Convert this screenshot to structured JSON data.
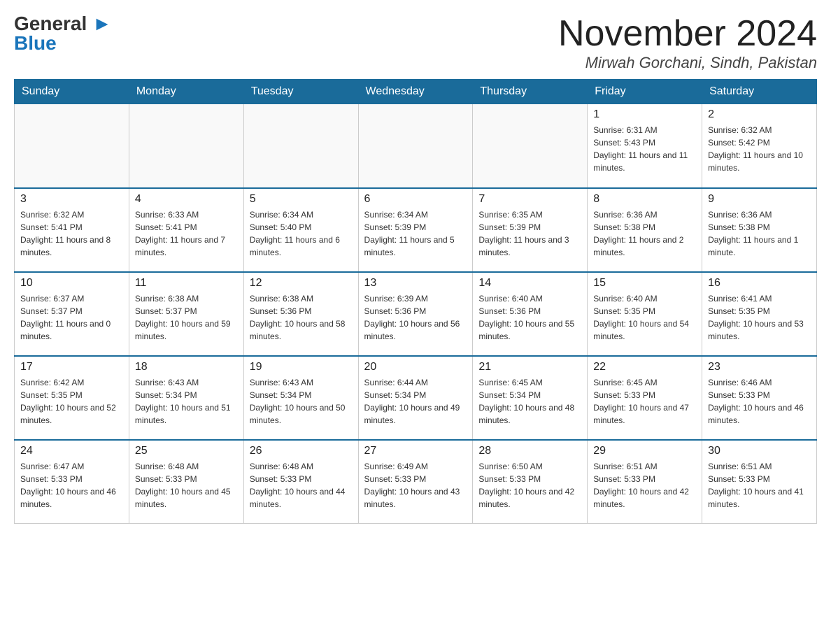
{
  "header": {
    "logo_general": "General",
    "logo_blue": "Blue",
    "month_title": "November 2024",
    "location": "Mirwah Gorchani, Sindh, Pakistan"
  },
  "weekdays": [
    "Sunday",
    "Monday",
    "Tuesday",
    "Wednesday",
    "Thursday",
    "Friday",
    "Saturday"
  ],
  "weeks": [
    [
      {
        "day": "",
        "sunrise": "",
        "sunset": "",
        "daylight": ""
      },
      {
        "day": "",
        "sunrise": "",
        "sunset": "",
        "daylight": ""
      },
      {
        "day": "",
        "sunrise": "",
        "sunset": "",
        "daylight": ""
      },
      {
        "day": "",
        "sunrise": "",
        "sunset": "",
        "daylight": ""
      },
      {
        "day": "",
        "sunrise": "",
        "sunset": "",
        "daylight": ""
      },
      {
        "day": "1",
        "sunrise": "Sunrise: 6:31 AM",
        "sunset": "Sunset: 5:43 PM",
        "daylight": "Daylight: 11 hours and 11 minutes."
      },
      {
        "day": "2",
        "sunrise": "Sunrise: 6:32 AM",
        "sunset": "Sunset: 5:42 PM",
        "daylight": "Daylight: 11 hours and 10 minutes."
      }
    ],
    [
      {
        "day": "3",
        "sunrise": "Sunrise: 6:32 AM",
        "sunset": "Sunset: 5:41 PM",
        "daylight": "Daylight: 11 hours and 8 minutes."
      },
      {
        "day": "4",
        "sunrise": "Sunrise: 6:33 AM",
        "sunset": "Sunset: 5:41 PM",
        "daylight": "Daylight: 11 hours and 7 minutes."
      },
      {
        "day": "5",
        "sunrise": "Sunrise: 6:34 AM",
        "sunset": "Sunset: 5:40 PM",
        "daylight": "Daylight: 11 hours and 6 minutes."
      },
      {
        "day": "6",
        "sunrise": "Sunrise: 6:34 AM",
        "sunset": "Sunset: 5:39 PM",
        "daylight": "Daylight: 11 hours and 5 minutes."
      },
      {
        "day": "7",
        "sunrise": "Sunrise: 6:35 AM",
        "sunset": "Sunset: 5:39 PM",
        "daylight": "Daylight: 11 hours and 3 minutes."
      },
      {
        "day": "8",
        "sunrise": "Sunrise: 6:36 AM",
        "sunset": "Sunset: 5:38 PM",
        "daylight": "Daylight: 11 hours and 2 minutes."
      },
      {
        "day": "9",
        "sunrise": "Sunrise: 6:36 AM",
        "sunset": "Sunset: 5:38 PM",
        "daylight": "Daylight: 11 hours and 1 minute."
      }
    ],
    [
      {
        "day": "10",
        "sunrise": "Sunrise: 6:37 AM",
        "sunset": "Sunset: 5:37 PM",
        "daylight": "Daylight: 11 hours and 0 minutes."
      },
      {
        "day": "11",
        "sunrise": "Sunrise: 6:38 AM",
        "sunset": "Sunset: 5:37 PM",
        "daylight": "Daylight: 10 hours and 59 minutes."
      },
      {
        "day": "12",
        "sunrise": "Sunrise: 6:38 AM",
        "sunset": "Sunset: 5:36 PM",
        "daylight": "Daylight: 10 hours and 58 minutes."
      },
      {
        "day": "13",
        "sunrise": "Sunrise: 6:39 AM",
        "sunset": "Sunset: 5:36 PM",
        "daylight": "Daylight: 10 hours and 56 minutes."
      },
      {
        "day": "14",
        "sunrise": "Sunrise: 6:40 AM",
        "sunset": "Sunset: 5:36 PM",
        "daylight": "Daylight: 10 hours and 55 minutes."
      },
      {
        "day": "15",
        "sunrise": "Sunrise: 6:40 AM",
        "sunset": "Sunset: 5:35 PM",
        "daylight": "Daylight: 10 hours and 54 minutes."
      },
      {
        "day": "16",
        "sunrise": "Sunrise: 6:41 AM",
        "sunset": "Sunset: 5:35 PM",
        "daylight": "Daylight: 10 hours and 53 minutes."
      }
    ],
    [
      {
        "day": "17",
        "sunrise": "Sunrise: 6:42 AM",
        "sunset": "Sunset: 5:35 PM",
        "daylight": "Daylight: 10 hours and 52 minutes."
      },
      {
        "day": "18",
        "sunrise": "Sunrise: 6:43 AM",
        "sunset": "Sunset: 5:34 PM",
        "daylight": "Daylight: 10 hours and 51 minutes."
      },
      {
        "day": "19",
        "sunrise": "Sunrise: 6:43 AM",
        "sunset": "Sunset: 5:34 PM",
        "daylight": "Daylight: 10 hours and 50 minutes."
      },
      {
        "day": "20",
        "sunrise": "Sunrise: 6:44 AM",
        "sunset": "Sunset: 5:34 PM",
        "daylight": "Daylight: 10 hours and 49 minutes."
      },
      {
        "day": "21",
        "sunrise": "Sunrise: 6:45 AM",
        "sunset": "Sunset: 5:34 PM",
        "daylight": "Daylight: 10 hours and 48 minutes."
      },
      {
        "day": "22",
        "sunrise": "Sunrise: 6:45 AM",
        "sunset": "Sunset: 5:33 PM",
        "daylight": "Daylight: 10 hours and 47 minutes."
      },
      {
        "day": "23",
        "sunrise": "Sunrise: 6:46 AM",
        "sunset": "Sunset: 5:33 PM",
        "daylight": "Daylight: 10 hours and 46 minutes."
      }
    ],
    [
      {
        "day": "24",
        "sunrise": "Sunrise: 6:47 AM",
        "sunset": "Sunset: 5:33 PM",
        "daylight": "Daylight: 10 hours and 46 minutes."
      },
      {
        "day": "25",
        "sunrise": "Sunrise: 6:48 AM",
        "sunset": "Sunset: 5:33 PM",
        "daylight": "Daylight: 10 hours and 45 minutes."
      },
      {
        "day": "26",
        "sunrise": "Sunrise: 6:48 AM",
        "sunset": "Sunset: 5:33 PM",
        "daylight": "Daylight: 10 hours and 44 minutes."
      },
      {
        "day": "27",
        "sunrise": "Sunrise: 6:49 AM",
        "sunset": "Sunset: 5:33 PM",
        "daylight": "Daylight: 10 hours and 43 minutes."
      },
      {
        "day": "28",
        "sunrise": "Sunrise: 6:50 AM",
        "sunset": "Sunset: 5:33 PM",
        "daylight": "Daylight: 10 hours and 42 minutes."
      },
      {
        "day": "29",
        "sunrise": "Sunrise: 6:51 AM",
        "sunset": "Sunset: 5:33 PM",
        "daylight": "Daylight: 10 hours and 42 minutes."
      },
      {
        "day": "30",
        "sunrise": "Sunrise: 6:51 AM",
        "sunset": "Sunset: 5:33 PM",
        "daylight": "Daylight: 10 hours and 41 minutes."
      }
    ]
  ]
}
